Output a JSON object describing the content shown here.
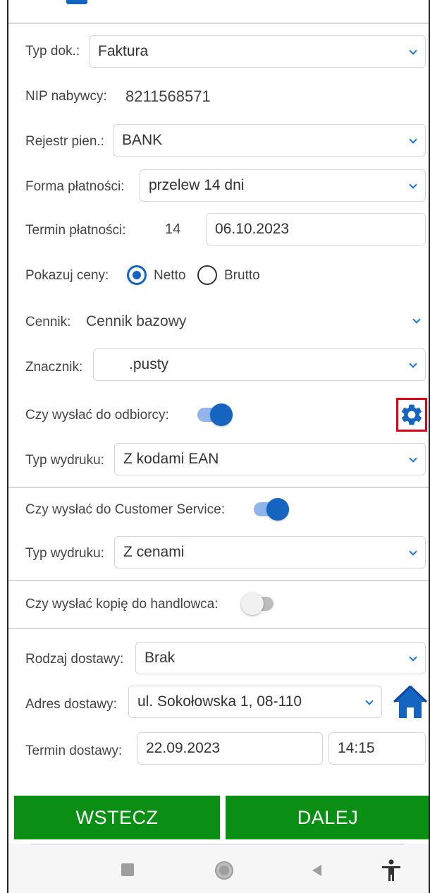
{
  "form": {
    "typ_dok": {
      "label": "Typ dok.:",
      "value": "Faktura"
    },
    "nip": {
      "label": "NIP nabywcy:",
      "value": "8211568571"
    },
    "rejestr": {
      "label": "Rejestr pien.:",
      "value": "BANK"
    },
    "forma": {
      "label": "Forma płatności:",
      "value": "przelew 14 dni"
    },
    "termin": {
      "label": "Termin płatności:",
      "days": "14",
      "date": "06.10.2023"
    },
    "ceny": {
      "label": "Pokazuj ceny:",
      "netto": "Netto",
      "brutto": "Brutto",
      "selected": "Netto"
    },
    "cennik": {
      "label": "Cennik:",
      "value": "Cennik bazowy"
    },
    "znacznik": {
      "label": "Znacznik:",
      "value": ".pusty"
    },
    "odbiorca": {
      "label": "Czy wysłać do odbiorcy:",
      "enabled": true
    },
    "typ_wydruku_1": {
      "label": "Typ wydruku:",
      "value": "Z kodami EAN"
    },
    "customer_service": {
      "label": "Czy wysłać do Customer Service:",
      "enabled": true
    },
    "typ_wydruku_2": {
      "label": "Typ wydruku:",
      "value": "Z cenami"
    },
    "handlowiec": {
      "label": "Czy wysłać kopię do handlowca:",
      "enabled": false
    },
    "rodzaj_dostawy": {
      "label": "Rodzaj dostawy:",
      "value": "Brak"
    },
    "adres_dostawy": {
      "label": "Adres dostawy:",
      "value": "ul. Sokołowska 1, 08-110"
    },
    "termin_dostawy": {
      "label": "Termin dostawy:",
      "date": "22.09.2023",
      "time": "14:15"
    }
  },
  "buttons": {
    "back": "WSTECZ",
    "next": "DALEJ"
  },
  "colors": {
    "accent": "#1565c0",
    "button_green": "#0a8f14",
    "highlight_red": "#e0001a"
  },
  "icons": [
    "gear-icon",
    "home-icon",
    "chevron-down-icon",
    "square-icon",
    "circle-icon",
    "back-triangle-icon",
    "accessibility-icon"
  ]
}
